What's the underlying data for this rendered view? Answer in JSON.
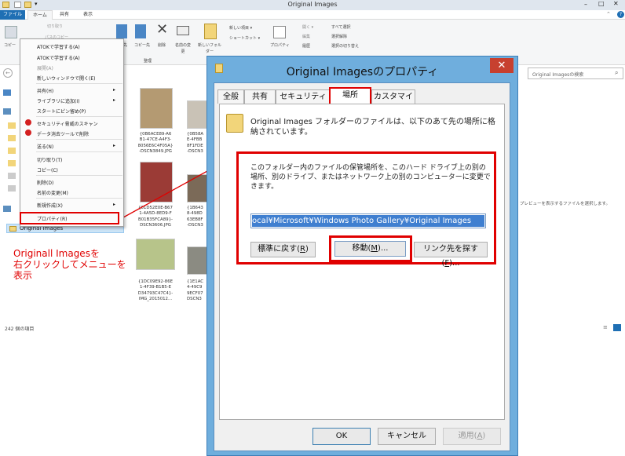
{
  "window": {
    "title": "Original Images",
    "controls": [
      "–",
      "□",
      "✕"
    ]
  },
  "ribbon_tabs": [
    "ファイル",
    "ホーム",
    "共有",
    "表示"
  ],
  "ribbon": {
    "copy": "コピー",
    "cut": "切り取り",
    "path_copy": "パスのコピー",
    "move_to": "移動先",
    "copy_to": "コピー先",
    "delete": "削除",
    "rename": "名前の変更",
    "new_folder": "新しいフォルダー",
    "new_item": "新しい項目 ▾",
    "shortcut": "ショートカット ▾",
    "properties": "プロパティ",
    "open": "開く ▾",
    "edit": "編集",
    "history": "履歴",
    "select_all": "すべて選択",
    "select_none": "選択解除",
    "invert": "選択の切り替え",
    "group_organize": "整理",
    "group_new": "新規"
  },
  "search_placeholder": "Original Imagesの検索",
  "preview_text": "プレビューを表示するファイルを選択します。",
  "status_count": "242 個の項目",
  "nav_selected": "Original Images",
  "context_menu": [
    {
      "label": "ATOKで学習する(A)"
    },
    {
      "label": "ATOKで学習する(A)"
    },
    {
      "label": "展開(A)",
      "disabled": true
    },
    {
      "label": "新しいウィンドウで開く(E)"
    },
    {
      "label": "共有(H)",
      "sub": true
    },
    {
      "label": "ライブラリに追加(I)",
      "sub": true
    },
    {
      "label": "スタートにピン留め(P)"
    },
    {
      "label": "セキュリティ脅威のスキャン",
      "icon": true
    },
    {
      "label": "データ消去ツールで削除",
      "icon": true
    },
    {
      "label": "送る(N)",
      "sub": true
    },
    {
      "label": "切り取り(T)"
    },
    {
      "label": "コピー(C)"
    },
    {
      "label": "削除(D)"
    },
    {
      "label": "名前の変更(M)"
    },
    {
      "label": "新規作成(X)",
      "sub": true
    },
    {
      "label": "プロパティ(R)"
    }
  ],
  "thumbnails": [
    {
      "lines": [
        "{0B6ACE89-A6",
        "B1-47CE-A4F3-",
        "8056E6C4F05A}",
        "-DSCN3849.JPG"
      ],
      "color": "#b49a72"
    },
    {
      "lines": [
        "{0B58A",
        "E-4FBB",
        "8F1FDE",
        "-DSCN3"
      ],
      "color": "#c9c2b6"
    },
    {
      "lines": [
        "{01D52E0E-B67",
        "1-4A5D-8ED9-F",
        "B01B35FCA89}-",
        "DSCN3606.JPG"
      ],
      "color": "#9b3b36"
    },
    {
      "lines": [
        "{1B643",
        "8-498D",
        "63EB8F",
        "-DSCN3"
      ],
      "color": "#7b6a58"
    },
    {
      "lines": [
        "{1DC09E92-86E",
        "1-4F39-B1B5-E",
        "D34793C47C4}-",
        "IMG_2015012..."
      ],
      "color": "#b7c48a"
    },
    {
      "lines": [
        "{1E1AC",
        "4-49C9",
        "9ECF07",
        "DSCN3"
      ],
      "color": "#8b8b82"
    }
  ],
  "annotation": [
    "Originall Imagesを",
    "右クリックしてメニューを",
    "表示"
  ],
  "dialog": {
    "title": "Original Imagesのプロパティ",
    "close": "✕",
    "tabs": [
      "全般",
      "共有",
      "セキュリティ",
      "場所",
      "カスタマイズ"
    ],
    "selected_tab": "場所",
    "desc": [
      "Original Images フォルダーのファイルは、以下のあて先の場所に格",
      "納されています。"
    ],
    "info": [
      "このフォルダー内のファイルの保管場所を、このハード ドライブ上の別の",
      "場所、別のドライブ、またはネットワーク上の別のコンピューターに変更で",
      "きます。"
    ],
    "path": "ocal¥Microsoft¥Windows Photo Gallery¥Original Images",
    "restore": "標準に戻す(",
    "restore_key": "R",
    "move": "移動(",
    "move_key": "M",
    "move_suffix": ")...",
    "find": "リンク先を探す(",
    "find_key": "F",
    "find_suffix": ")...",
    "ok": "OK",
    "cancel": "キャンセル",
    "apply": "適用(",
    "apply_key": "A"
  },
  "colors": {
    "accent": "#1f6fb4",
    "highlight": "#e00000",
    "dialog_frame": "#6faedd"
  }
}
